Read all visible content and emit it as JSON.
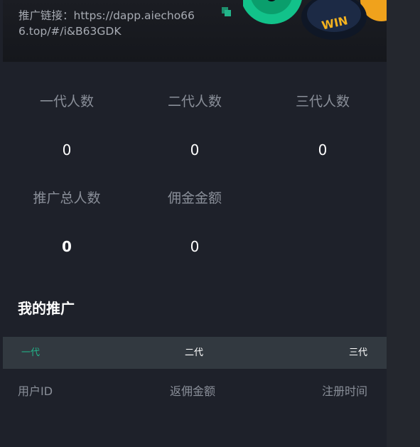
{
  "referral": {
    "label": "推广链接：",
    "url": "https://dapp.aiecho666.top/#/i&B63GDK",
    "coin_text": "WIN"
  },
  "stats": [
    {
      "label": "一代人数",
      "value": "0"
    },
    {
      "label": "二代人数",
      "value": "0"
    },
    {
      "label": "三代人数",
      "value": "0"
    },
    {
      "label": "推广总人数",
      "value": "0"
    },
    {
      "label": "佣金金额",
      "value": "0"
    }
  ],
  "section": {
    "title": "我的推广"
  },
  "tabs": [
    {
      "label": "一代",
      "active": true
    },
    {
      "label": "二代",
      "active": false
    },
    {
      "label": "三代",
      "active": false
    }
  ],
  "table": {
    "headers": [
      "用户ID",
      "返佣金额",
      "注册时间"
    ]
  },
  "colors": {
    "accent": "#22b58a",
    "background": "#1e212a",
    "tab_bar": "#323940",
    "muted_text": "#8a8f99"
  },
  "icons": {
    "copy": "copy-icon"
  }
}
